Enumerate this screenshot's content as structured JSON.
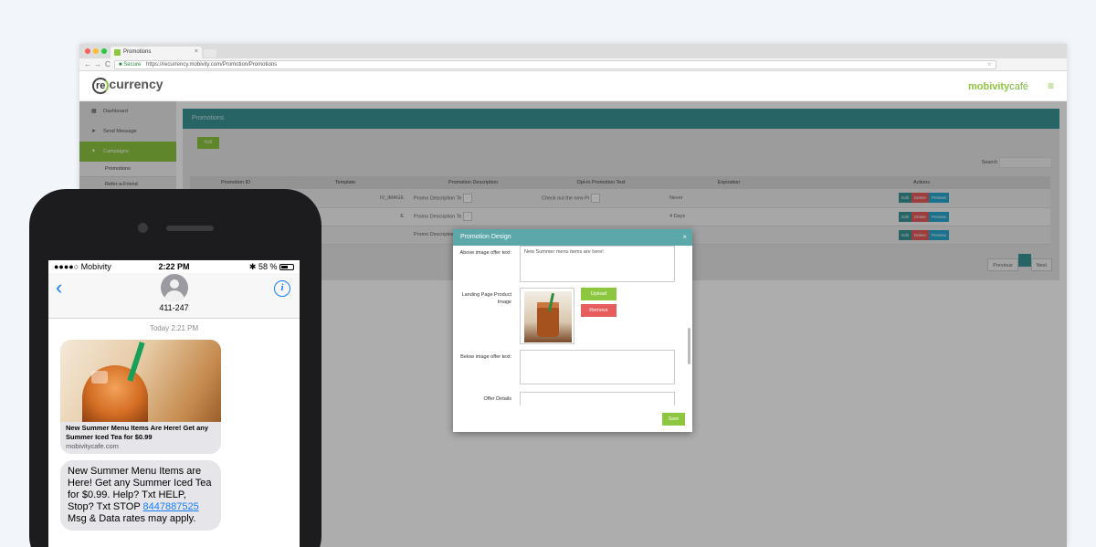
{
  "browser": {
    "tab_title": "Promotions",
    "tab_close": "×",
    "nav_back": "←",
    "nav_forward": "→",
    "nav_reload": "C",
    "secure_label": "Secure",
    "url": "https://recurrency.mobivity.com/Promotion/Promotions",
    "star": "☆"
  },
  "app": {
    "logo_re": "re",
    "logo_rest": "currency",
    "brand": "mobivity",
    "brand_cafe": "café",
    "menu_icon": "≡"
  },
  "sidebar": {
    "items": [
      {
        "icon": "▦",
        "label": "Dashboard"
      },
      {
        "icon": "➤",
        "label": "Send Message"
      },
      {
        "icon": "✦",
        "label": "Campaigns"
      }
    ],
    "subitems": [
      "Promotions",
      "Refer-a-Friend"
    ]
  },
  "page": {
    "title": "Promotions",
    "add_label": "Add",
    "search_label": "Search",
    "columns": [
      "Promotion ID",
      "Template",
      "Promotion Description",
      "Opt-in Promotion Text",
      "Expiration",
      "Actions"
    ],
    "rows": [
      {
        "id": "",
        "template": "IV_IMAGE",
        "desc": "Promo Description Te",
        "optin": "Check out the new Pr",
        "exp": "Never"
      },
      {
        "id": "",
        "template": "E",
        "desc": "Promo Description Te",
        "optin": "",
        "exp": "4 Days"
      },
      {
        "id": "",
        "template": "",
        "desc": "Promo Description",
        "optin": "",
        "exp": ""
      }
    ],
    "actions": {
      "edit": "Edit",
      "delete": "Delete",
      "preview": "Preview"
    },
    "pager": {
      "previous": "Previous",
      "page": "",
      "next": "Next"
    }
  },
  "modal": {
    "title": "Promotion Design",
    "close": "×",
    "above_label": "Above image offer text:",
    "above_value": "New Summer menu items are here!",
    "landing_label": "Landing Page Product Image",
    "upload_label": "Upload",
    "remove_label": "Remove",
    "below_label": "Below image offer text:",
    "offer_label": "Offer Details",
    "save_label": "Save"
  },
  "phone": {
    "carrier": "●●●●○ Mobivity",
    "time": "2:22 PM",
    "battery": "58 %",
    "bluetooth": "✱",
    "back": "‹",
    "contact": "411-247",
    "info": "i",
    "timestamp": "Today 2:21 PM",
    "card_title": "New Summer Menu Items Are Here! Get any Summer Iced Tea for $0.99",
    "card_url": "mobivitycafe.com",
    "msg_text_1": "New Summer Menu Items are Here! Get any Summer Iced Tea for $0.99. Help? Txt HELP, Stop? Txt STOP ",
    "msg_link": "8447887525",
    "msg_text_2": " Msg & Data rates may apply."
  },
  "colors": {
    "teal": "#3a9496",
    "green": "#8dc63f",
    "red": "#e75c5c",
    "blue": "#29a8d0",
    "ios_blue": "#157efb"
  }
}
